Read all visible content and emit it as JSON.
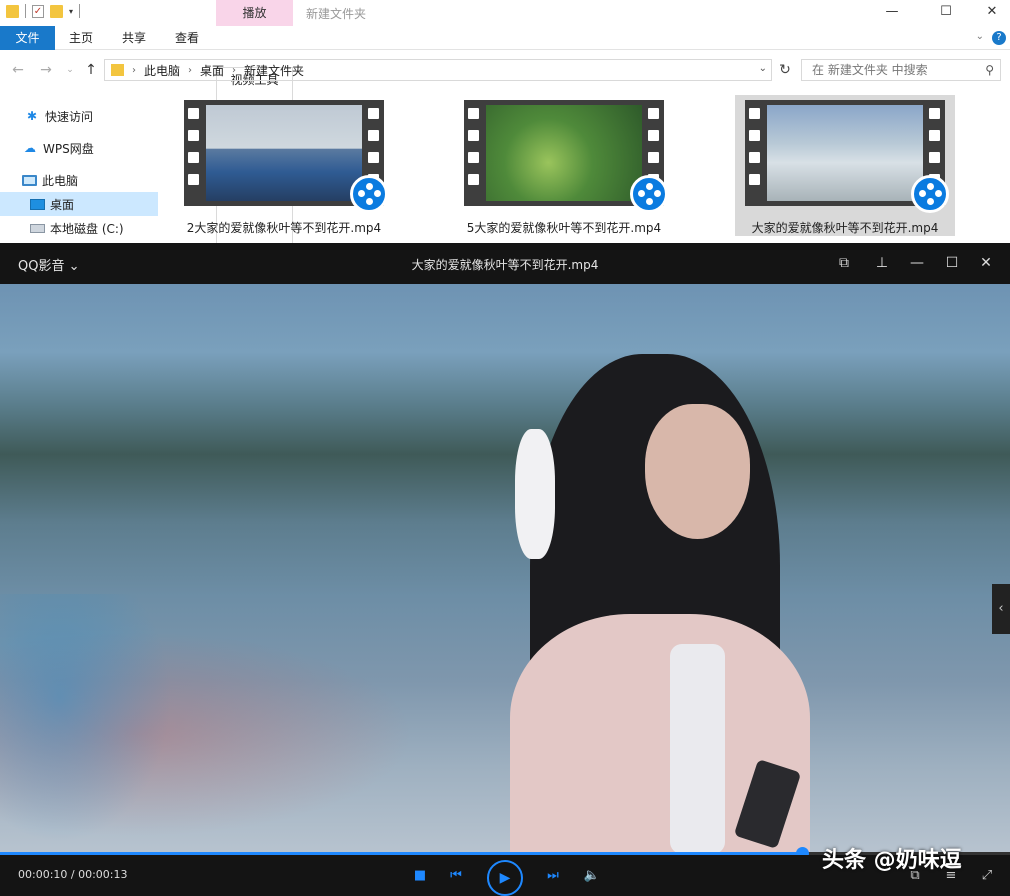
{
  "explorer": {
    "context_tab": "播放",
    "window_title": "新建文件夹",
    "ribbon_tabs": [
      "文件",
      "主页",
      "共享",
      "查看",
      "视频工具"
    ],
    "address": {
      "crumbs": [
        "此电脑",
        "桌面",
        "新建文件夹"
      ]
    },
    "search": {
      "placeholder": "在 新建文件夹 中搜索"
    },
    "sidebar": {
      "items": [
        {
          "label": "快速访问",
          "icon": "star-icon"
        },
        {
          "label": "WPS网盘",
          "icon": "cloud-icon"
        },
        {
          "label": "此电脑",
          "icon": "pc-icon"
        },
        {
          "label": "桌面",
          "icon": "desktop-icon",
          "selected": true
        },
        {
          "label": "本地磁盘 (C:)",
          "icon": "drive-icon"
        }
      ]
    },
    "files": [
      {
        "name": "2大家的爱就像秋叶等不到花开.mp4"
      },
      {
        "name": "5大家的爱就像秋叶等不到花开.mp4"
      },
      {
        "name": "大家的爱就像秋叶等不到花开.mp4",
        "selected": true
      }
    ]
  },
  "player": {
    "brand": "QQ影音",
    "title": "大家的爱就像秋叶等不到花开.mp4",
    "time": "00:00:10 / 00:00:13",
    "progress": 0.794,
    "accent": "#1e88ff"
  },
  "watermark": "头条 @奶味逗"
}
